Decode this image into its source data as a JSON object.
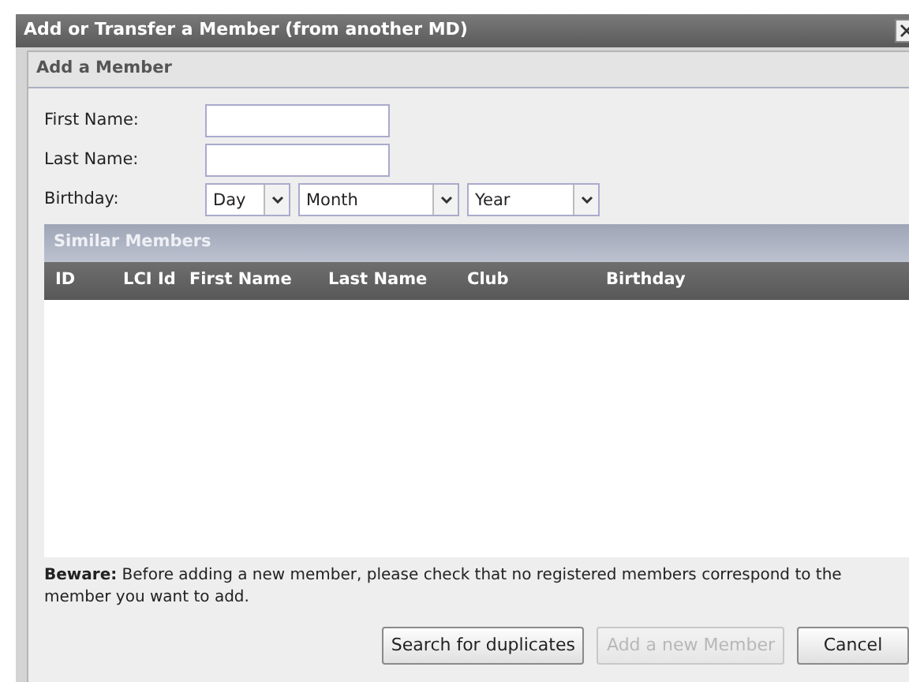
{
  "window": {
    "title": "Add or Transfer a Member (from another MD)"
  },
  "panel": {
    "title": "Add a Member"
  },
  "form": {
    "fields": [
      {
        "label": "First Name:"
      },
      {
        "label": "Last Name:"
      }
    ],
    "birthday": {
      "label": "Birthday:",
      "selects": [
        "Day",
        "Month",
        "Year"
      ]
    }
  },
  "similar_members": {
    "title": "Similar Members",
    "columns": [
      "ID",
      "LCI Id",
      "First Name",
      "Last Name",
      "Club",
      "Birthday"
    ]
  },
  "notice": "**Beware:** Before adding a new member, please check that no registered members correspond to the member you want to add.",
  "buttons": [
    {
      "label": "Search for duplicates",
      "disabled": false
    },
    {
      "label": "Add a new Member",
      "disabled": true
    },
    {
      "label": "Cancel",
      "disabled": false
    }
  ]
}
